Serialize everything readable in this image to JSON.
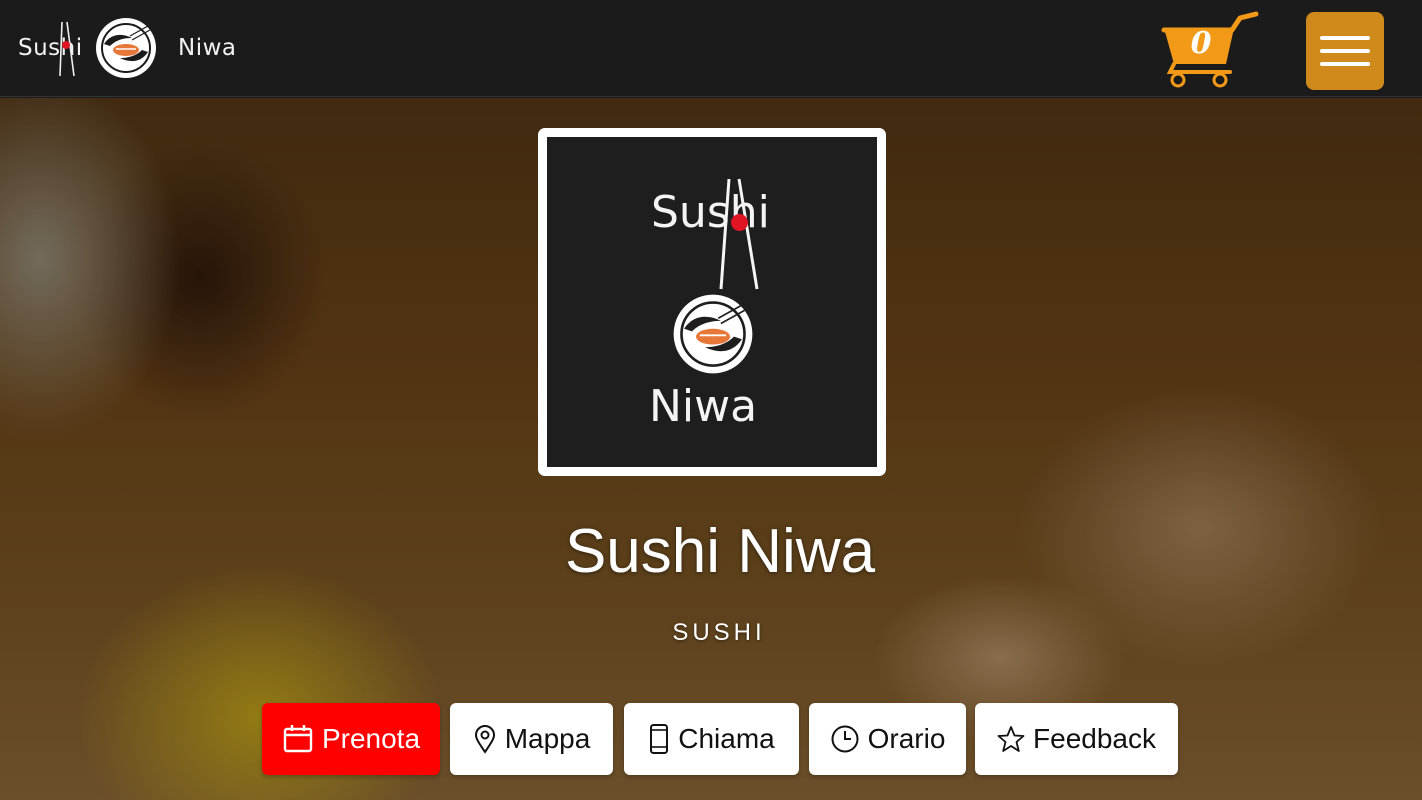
{
  "header": {
    "brand_sushi": "Sushi",
    "brand_niwa": "Niwa",
    "cart_count": "0"
  },
  "logo": {
    "sushi": "Sushi",
    "niwa": "Niwa"
  },
  "venue": {
    "name": "Sushi Niwa",
    "category": "SUSHI"
  },
  "actions": {
    "prenota": "Prenota",
    "mappa": "Mappa",
    "chiama": "Chiama",
    "orario": "Orario",
    "feedback": "Feedback"
  },
  "colors": {
    "accent_orange": "#d08a1b",
    "cart_orange": "#f29a17",
    "primary_red": "#ff0000",
    "logo_red": "#e01422"
  },
  "icons": {
    "cart": "shopping-cart-icon",
    "menu": "hamburger-menu-icon",
    "prenota": "calendar-icon",
    "mappa": "map-pin-icon",
    "chiama": "phone-icon",
    "orario": "clock-icon",
    "feedback": "star-icon"
  }
}
